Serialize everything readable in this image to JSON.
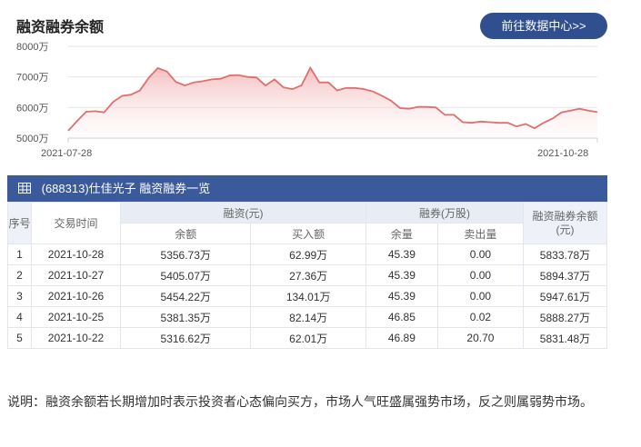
{
  "header": {
    "title": "融资融券余额",
    "button_label": "前往数据中心>>"
  },
  "chart_data": {
    "type": "area",
    "title": "融资融券余额",
    "y_tick_labels": [
      "8000万",
      "7000万",
      "6000万",
      "5000万"
    ],
    "y_ticks": [
      8000,
      7000,
      6000,
      5000
    ],
    "ylim": [
      5000,
      8000
    ],
    "x_tick_labels": [
      "2021-07-28",
      "2021-10-28"
    ],
    "grid": true,
    "series": [
      {
        "color": "#e06f6f",
        "values": [
          5240,
          5560,
          5860,
          5880,
          5840,
          6180,
          6380,
          6420,
          6560,
          6980,
          7290,
          7180,
          6840,
          6720,
          6820,
          6860,
          6920,
          6940,
          7050,
          7060,
          7000,
          6980,
          6720,
          6920,
          6660,
          6600,
          6720,
          7300,
          6820,
          6820,
          6560,
          6640,
          6640,
          6600,
          6520,
          6380,
          6220,
          5980,
          5960,
          6020,
          6020,
          6000,
          5760,
          5760,
          5520,
          5500,
          5540,
          5520,
          5500,
          5500,
          5380,
          5460,
          5320,
          5500,
          5640,
          5840,
          5900,
          5960,
          5900,
          5850
        ]
      }
    ]
  },
  "table": {
    "title": "(688313)仕佳光子 融资融券一览",
    "headers": {
      "seq": "序号",
      "time": "交易时间",
      "margin": "融资(元)",
      "short": "融券(万股)",
      "total": "融资融券余额(元)",
      "margin_balance": "余额",
      "margin_buy": "买入额",
      "short_balance": "余量",
      "short_sell": "卖出量"
    },
    "rows": [
      {
        "seq": "1",
        "date": "2021-10-28",
        "mb": "5356.73万",
        "buy": "62.99万",
        "sb": "45.39",
        "sell": "0.00",
        "total": "5833.78万"
      },
      {
        "seq": "2",
        "date": "2021-10-27",
        "mb": "5405.07万",
        "buy": "27.36万",
        "sb": "45.39",
        "sell": "0.00",
        "total": "5894.37万"
      },
      {
        "seq": "3",
        "date": "2021-10-26",
        "mb": "5454.22万",
        "buy": "134.01万",
        "sb": "45.39",
        "sell": "0.00",
        "total": "5947.61万"
      },
      {
        "seq": "4",
        "date": "2021-10-25",
        "mb": "5381.35万",
        "buy": "82.14万",
        "sb": "46.85",
        "sell": "0.02",
        "total": "5888.27万"
      },
      {
        "seq": "5",
        "date": "2021-10-22",
        "mb": "5316.62万",
        "buy": "62.01万",
        "sb": "46.89",
        "sell": "20.70",
        "total": "5831.48万"
      }
    ]
  },
  "note": "说明：融资余额若长期增加时表示投资者心态偏向买方，市场人气旺盛属强势市场，反之则属弱势市场。"
}
